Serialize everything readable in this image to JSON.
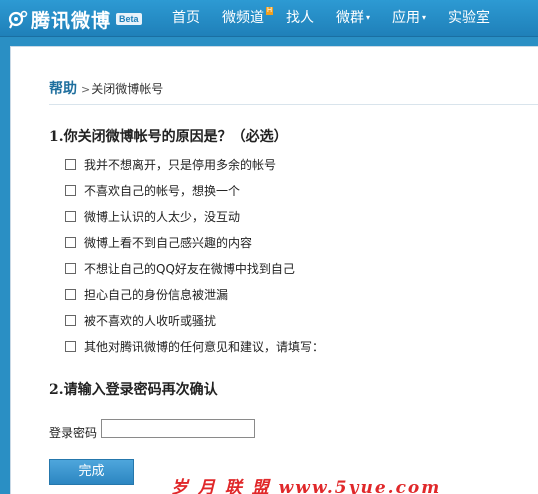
{
  "header": {
    "logo_text": "腾讯微博",
    "beta_label": "Beta",
    "nav": [
      {
        "label": "首页",
        "caret": false,
        "badge": ""
      },
      {
        "label": "微频道",
        "caret": false,
        "badge": "H"
      },
      {
        "label": "找人",
        "caret": false,
        "badge": ""
      },
      {
        "label": "微群",
        "caret": true,
        "badge": ""
      },
      {
        "label": "应用",
        "caret": true,
        "badge": ""
      },
      {
        "label": "实验室",
        "caret": false,
        "badge": ""
      }
    ],
    "caret_glyph": "▾"
  },
  "breadcrumb": {
    "home": "帮助",
    "separator": ">",
    "current": "关闭微博帐号"
  },
  "question1": {
    "title": "1.你关闭微博帐号的原因是？（必选）",
    "options": [
      "我并不想离开，只是停用多余的帐号",
      "不喜欢自己的帐号，想换一个",
      "微博上认识的人太少，没互动",
      "微博上看不到自己感兴趣的内容",
      "不想让自己的QQ好友在微博中找到自己",
      "担心自己的身份信息被泄漏",
      "被不喜欢的人收听或骚扰",
      "其他对腾讯微博的任何意见和建议，请填写："
    ]
  },
  "question2": {
    "title": "2.请输入登录密码再次确认",
    "password_label": "登录密码",
    "password_value": ""
  },
  "submit_label": "完成",
  "watermark": "岁 月 联 盟   www.5yue.com",
  "colors": {
    "nav_bg": "#2d9ad3",
    "link": "#1f6f9e",
    "button": "#2c86c1",
    "watermark": "#e0282a"
  }
}
